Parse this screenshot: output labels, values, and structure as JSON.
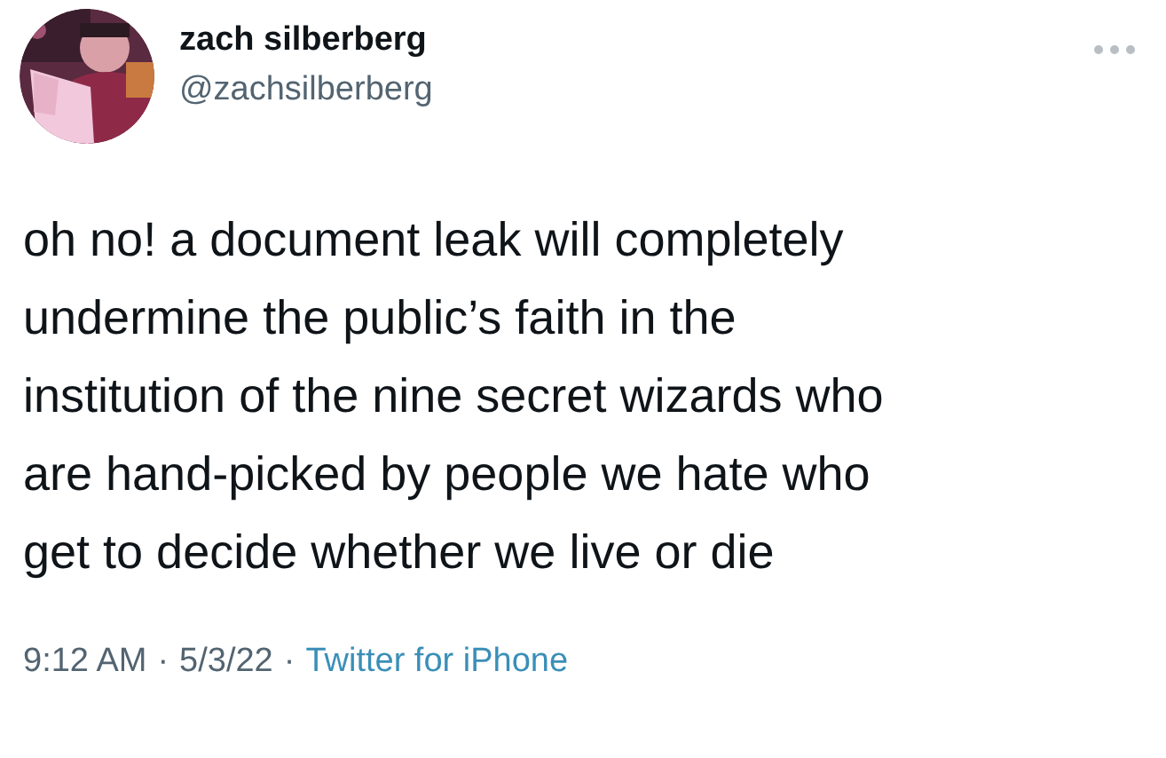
{
  "author": {
    "name": "zach silberberg",
    "handle": "@zachsilberberg"
  },
  "tweet": {
    "lines": [
      "oh no! a document leak will completely",
      "undermine the public’s faith in the",
      "institution of the nine secret wizards who",
      "are hand-picked by people we hate who",
      "get to decide whether we live or die"
    ]
  },
  "meta": {
    "time": "9:12 AM",
    "separator_1": "·",
    "date": "5/3/22",
    "separator_2": "·",
    "source": "Twitter for iPhone"
  }
}
